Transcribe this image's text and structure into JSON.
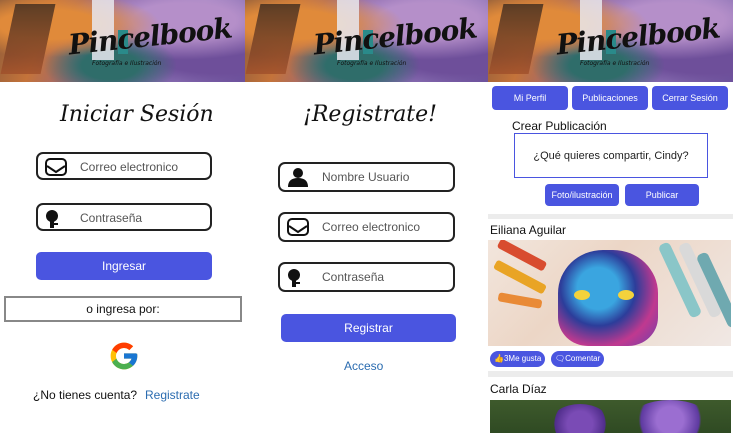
{
  "brand": {
    "logo": "Pincelbook",
    "tagline": "Fotografía e Ilustración"
  },
  "login": {
    "title": "Iniciar Sesión",
    "email_placeholder": "Correo electronico",
    "password_placeholder": "Contraseña",
    "submit_label": "Ingresar",
    "alt_login_label": "o ingresa por:",
    "no_account_text": "¿No tienes cuenta?",
    "register_link": "Registrate"
  },
  "register": {
    "title": "¡Registrate!",
    "username_placeholder": "Nombre Usuario",
    "email_placeholder": "Correo electronico",
    "password_placeholder": "Contraseña",
    "submit_label": "Registrar",
    "login_link": "Acceso"
  },
  "feed": {
    "nav": [
      "Mi Perfil",
      "Publicaciones",
      "Cerrar Sesión"
    ],
    "create_title": "Crear Publicación",
    "create_prompt": "¿Qué quieres compartir, Cindy?",
    "photo_button": "Foto/ilustración",
    "publish_button": "Publicar",
    "posts": [
      {
        "author": "Eiliana Aguilar",
        "likes_label": "3Me gusta",
        "comment_label": "Comentar"
      },
      {
        "author": "Carla Díaz"
      }
    ]
  },
  "colors": {
    "primary": "#4a55e0",
    "link": "#2b6cb0"
  }
}
